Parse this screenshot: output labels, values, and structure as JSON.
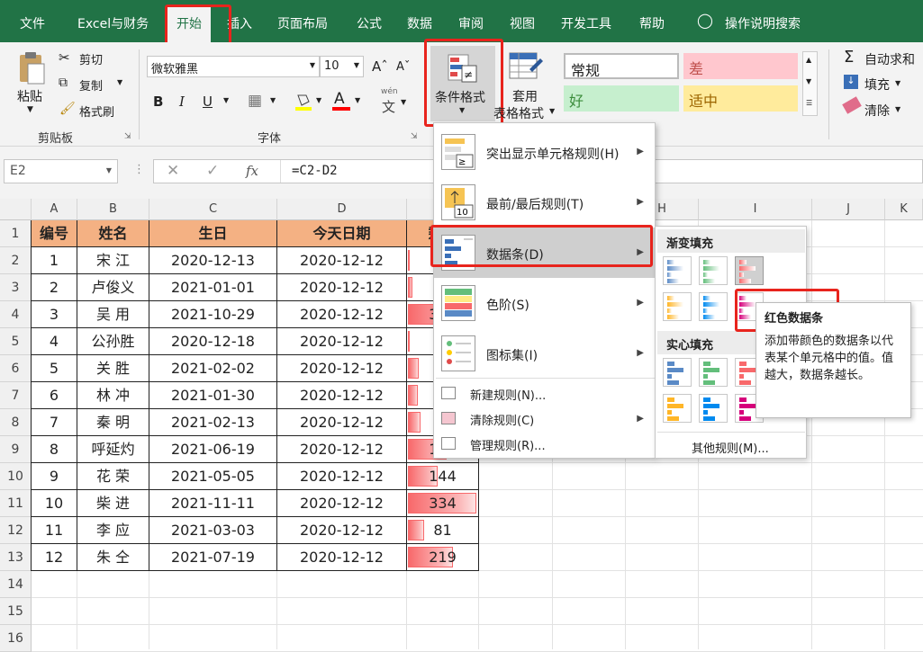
{
  "menubar": {
    "tabs": [
      "文件",
      "Excel与财务",
      "开始",
      "插入",
      "页面布局",
      "公式",
      "数据",
      "审阅",
      "视图",
      "开发工具",
      "帮助"
    ],
    "search": "操作说明搜索"
  },
  "ribbon": {
    "paste": "粘贴",
    "cut": "剪切",
    "copy": "复制",
    "format_painter": "格式刷",
    "clipboard": "剪贴板",
    "font_name": "微软雅黑",
    "font_size": "10",
    "bold": "B",
    "italic": "I",
    "underline": "U",
    "font_group": "字体",
    "phonetic_top": "wén",
    "phonetic": "文",
    "cond_format": "条件格式",
    "table_format_1": "套用",
    "table_format_2": "表格格式",
    "styles": {
      "normal": "常规",
      "bad": "差",
      "good": "好",
      "neutral": "适中"
    },
    "autosum": "自动求和",
    "fill": "填充",
    "clear": "清除"
  },
  "formula": {
    "namebox": "E2",
    "fx": "fx",
    "content": "=C2-D2"
  },
  "columns": [
    "A",
    "B",
    "C",
    "D",
    "E",
    "F",
    "G",
    "H",
    "I",
    "J",
    "K"
  ],
  "rows": [
    "1",
    "2",
    "3",
    "4",
    "5",
    "6",
    "7",
    "8",
    "9",
    "10",
    "11",
    "12",
    "13",
    "14",
    "15",
    "16"
  ],
  "table": {
    "headers": [
      "编号",
      "姓名",
      "生日",
      "今天日期",
      "剩余"
    ],
    "rows": [
      {
        "id": "1",
        "name": "宋 江",
        "birth": "2020-12-13",
        "today": "2020-12-12",
        "remain": "1"
      },
      {
        "id": "2",
        "name": "卢俊义",
        "birth": "2021-01-01",
        "today": "2020-12-12",
        "remain": "20"
      },
      {
        "id": "3",
        "name": "吴 用",
        "birth": "2021-10-29",
        "today": "2020-12-12",
        "remain": "321"
      },
      {
        "id": "4",
        "name": "公孙胜",
        "birth": "2020-12-18",
        "today": "2020-12-12",
        "remain": "6"
      },
      {
        "id": "5",
        "name": "关 胜",
        "birth": "2021-02-02",
        "today": "2020-12-12",
        "remain": "52"
      },
      {
        "id": "6",
        "name": "林 冲",
        "birth": "2021-01-30",
        "today": "2020-12-12",
        "remain": "49"
      },
      {
        "id": "7",
        "name": "秦 明",
        "birth": "2021-02-13",
        "today": "2020-12-12",
        "remain": "63"
      },
      {
        "id": "8",
        "name": "呼延灼",
        "birth": "2021-06-19",
        "today": "2020-12-12",
        "remain": "189"
      },
      {
        "id": "9",
        "name": "花 荣",
        "birth": "2021-05-05",
        "today": "2020-12-12",
        "remain": "144"
      },
      {
        "id": "10",
        "name": "柴 进",
        "birth": "2021-11-11",
        "today": "2020-12-12",
        "remain": "334"
      },
      {
        "id": "11",
        "name": "李 应",
        "birth": "2021-03-03",
        "today": "2020-12-12",
        "remain": "81"
      },
      {
        "id": "12",
        "name": "朱 仝",
        "birth": "2021-07-19",
        "today": "2020-12-12",
        "remain": "219"
      }
    ],
    "remain_max": 334
  },
  "cf_menu": {
    "items": [
      "突出显示单元格规则(H)",
      "最前/最后规则(T)",
      "数据条(D)",
      "色阶(S)",
      "图标集(I)"
    ],
    "actions": [
      "新建规则(N)...",
      "清除规则(C)",
      "管理规则(R)..."
    ]
  },
  "databar_menu": {
    "gradient": "渐变填充",
    "solid": "实心填充",
    "more": "其他规则(M)..."
  },
  "tooltip": {
    "title": "红色数据条",
    "body": "添加带颜色的数据条以代表某个单元格中的值。值越大，数据条越长。"
  },
  "colors": {
    "accent": "#217346",
    "header_fill": "#f4b183",
    "bar_red": "#f8696b",
    "highlight": "#e8241d"
  }
}
